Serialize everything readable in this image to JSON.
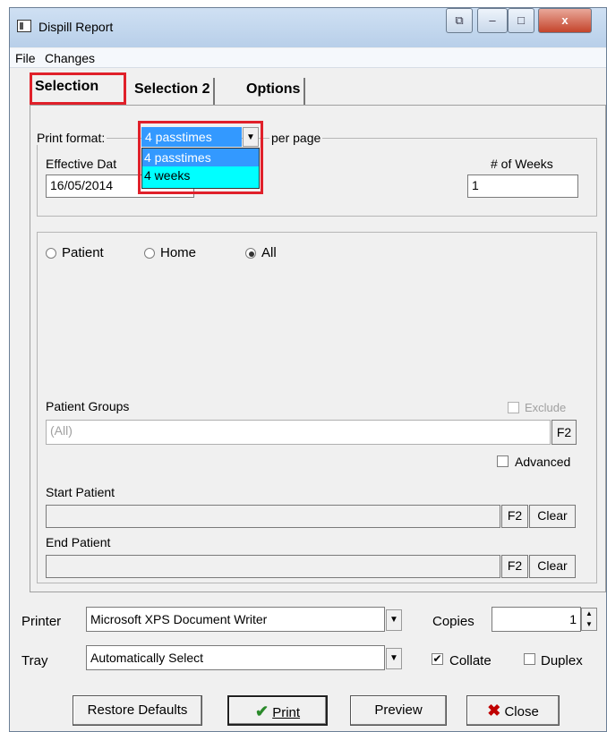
{
  "window": {
    "title": "Dispill Report",
    "title_buttons": [
      "⧉",
      "–",
      "□",
      "x"
    ]
  },
  "menu": [
    "File",
    "Changes"
  ],
  "tabs": [
    {
      "label": "Selection",
      "active": true
    },
    {
      "label": "Selection 2"
    },
    {
      "label": "Options"
    }
  ],
  "print_format": {
    "label": "Print format:",
    "value": "4 passtimes",
    "suffix": "per page",
    "options": [
      "4 passtimes",
      "4 weeks"
    ]
  },
  "effective_date": {
    "label": "Effective Dat",
    "value": "16/05/2014"
  },
  "weeks": {
    "label": "# of Weeks",
    "value": "1"
  },
  "scope": {
    "options": [
      "Patient",
      "Home",
      "All"
    ],
    "selected": "All"
  },
  "patient_groups": {
    "label": "Patient Groups",
    "value": "(All)",
    "f2": "F2",
    "exclude_label": "Exclude"
  },
  "advanced_label": "Advanced",
  "start_patient": {
    "label": "Start Patient",
    "f2": "F2",
    "clear": "Clear"
  },
  "end_patient": {
    "label": "End Patient",
    "f2": "F2",
    "clear": "Clear"
  },
  "printer": {
    "label": "Printer",
    "value": "Microsoft XPS Document Writer"
  },
  "copies": {
    "label": "Copies",
    "value": "1"
  },
  "tray": {
    "label": "Tray",
    "value": "Automatically Select"
  },
  "collate_label": "Collate",
  "duplex_label": "Duplex",
  "buttons": {
    "restore": "Restore Defaults",
    "print": "Print",
    "preview": "Preview",
    "close": "Close"
  },
  "colors": {
    "highlight": "#3399ff",
    "list_bg": "#00ffff",
    "red_outline": "#e0202a",
    "close_icon": "#c00000",
    "check_icon": "#2a8a2a"
  }
}
